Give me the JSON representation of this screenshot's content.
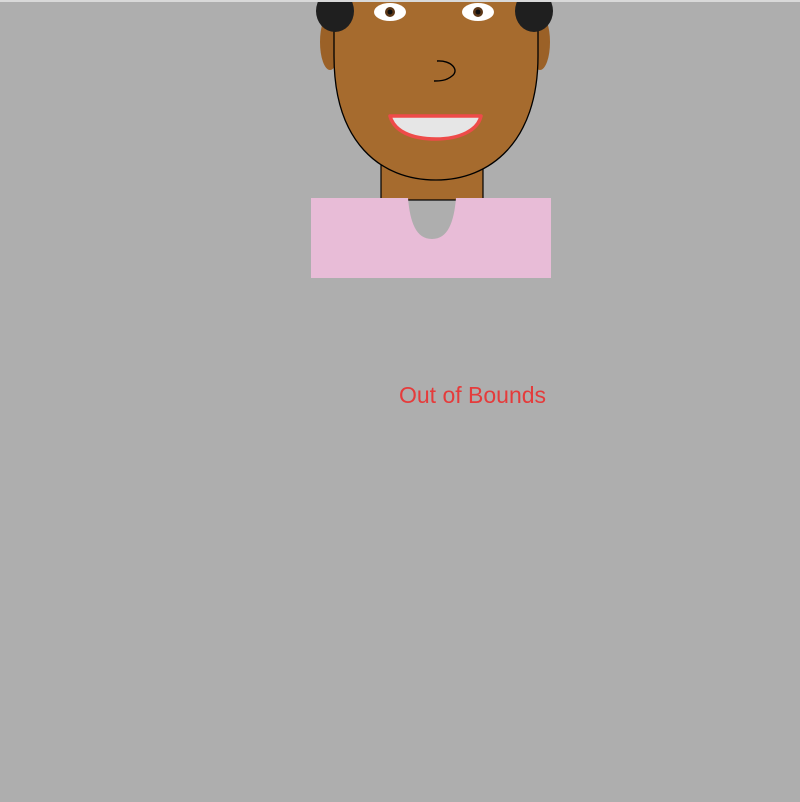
{
  "status_message": "Out of Bounds",
  "colors": {
    "background": "#aeaeae",
    "skin": "#a66b2e",
    "hair": "#1f1f1f",
    "shirt": "#e8bcd7",
    "mouth_fill": "#e6e6e6",
    "mouth_outline": "#ee4b49",
    "message_text": "#e53b3b"
  }
}
